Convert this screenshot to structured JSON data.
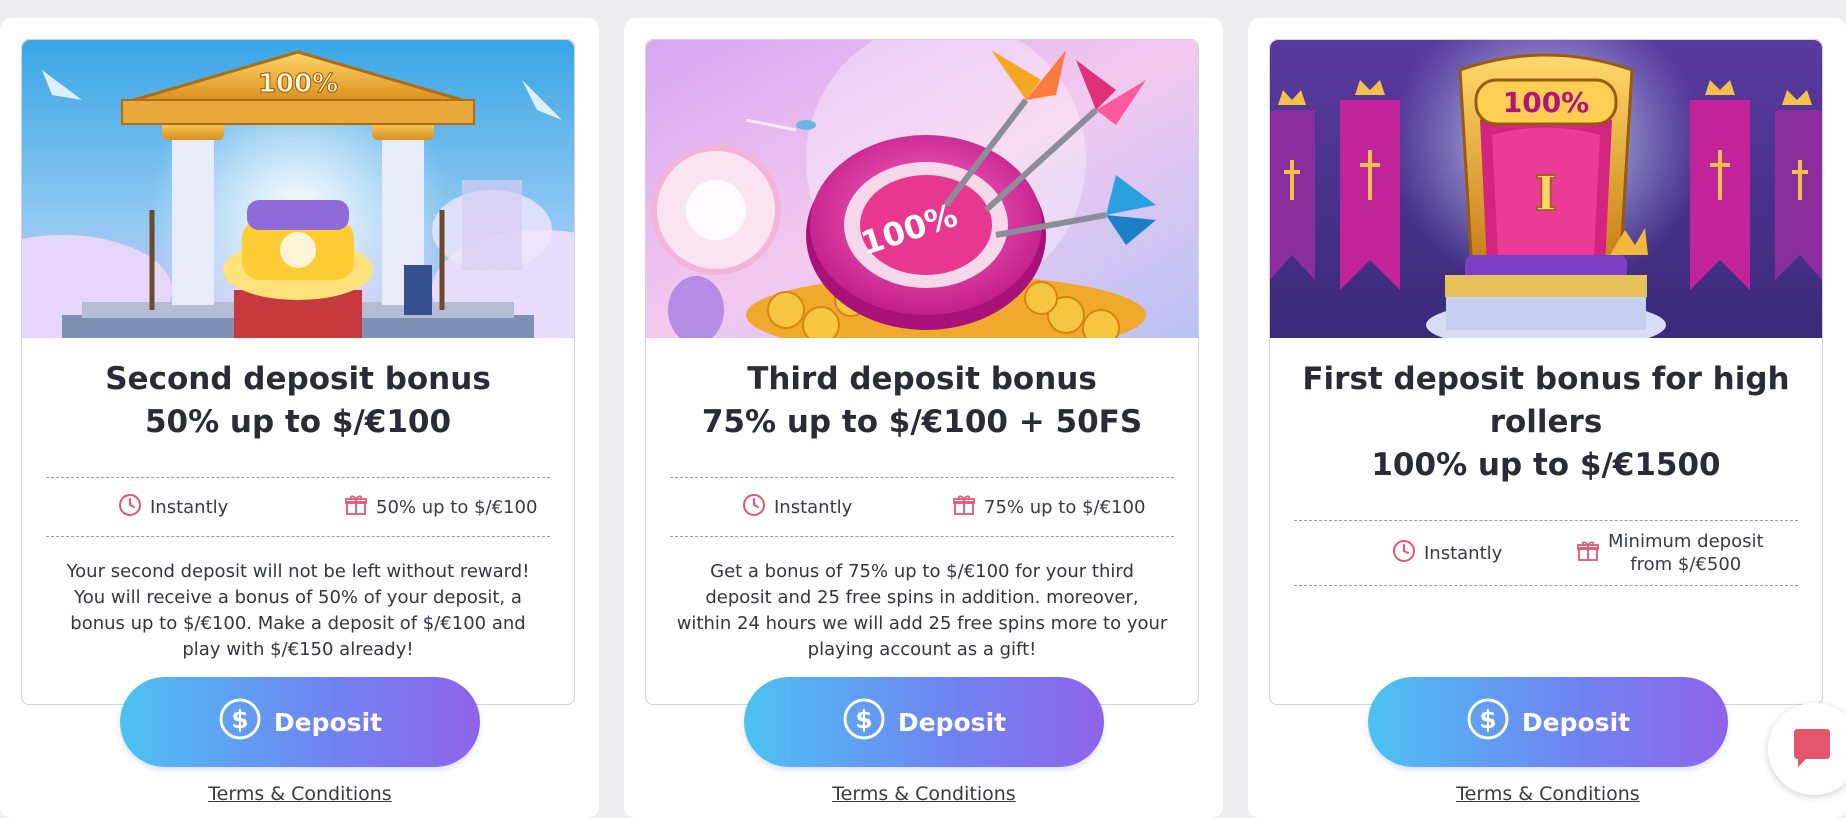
{
  "cards": [
    {
      "title_lines": [
        "Second deposit bonus",
        "50% up to $/€100"
      ],
      "art_badge": "100%",
      "timing": "Instantly",
      "bonus": "50% up to $/€100",
      "description": "Your second deposit will not be left without reward! You will receive a bonus of 50% of your deposit, a bonus up to $/€100. Make a deposit of $/€100 and play with $/€150 already!",
      "button_label": "Deposit",
      "terms_label": "Terms & Conditions"
    },
    {
      "title_lines": [
        "Third deposit bonus",
        "75% up to $/€100 + 50FS"
      ],
      "art_badge": "100%",
      "timing": "Instantly",
      "bonus": "75% up to $/€100",
      "description": "Get a bonus of 75% up to $/€100 for your third deposit and 25 free spins in addition. moreover, within 24 hours we will add 25 free spins more to your playing account as a gift!",
      "button_label": "Deposit",
      "terms_label": "Terms & Conditions"
    },
    {
      "title_lines": [
        "First deposit bonus for high",
        "rollers",
        "100% up to $/€1500"
      ],
      "art_badge": "100%",
      "art_numeral": "I",
      "timing": "Instantly",
      "bonus_lines": [
        "Minimum deposit",
        "from $/€500"
      ],
      "button_label": "Deposit",
      "terms_label": "Terms & Conditions"
    }
  ],
  "icons": {
    "clock": "clock-icon",
    "gift": "gift-icon",
    "dollar": "dollar-coin-icon",
    "chat": "chat-bubble-icon"
  },
  "colors": {
    "accent_pink": "#e4566f",
    "button_start": "#4cc3f2",
    "button_end": "#8e63ea"
  }
}
